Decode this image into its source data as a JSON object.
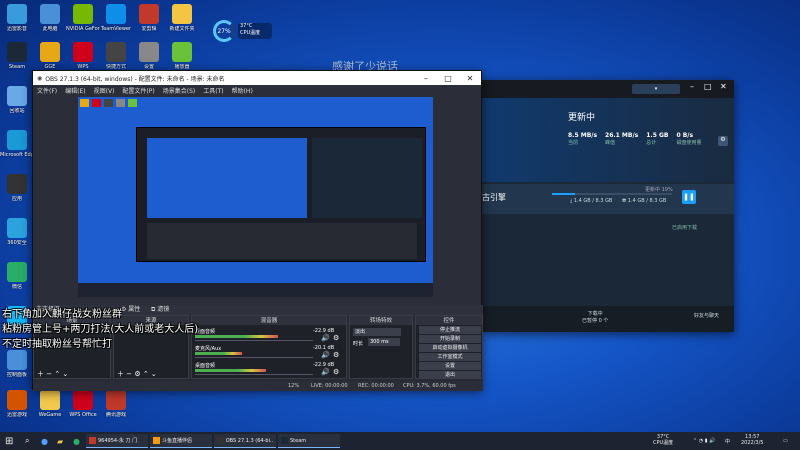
{
  "desktop": {
    "icons_top": [
      {
        "label": "迅雷影音",
        "icon": "app-icon",
        "color": "#3a9bdc"
      },
      {
        "label": "此电脑",
        "icon": "computer-icon",
        "color": "#4a90d9"
      },
      {
        "label": "NVIDIA GeForce",
        "icon": "nvidia-icon",
        "color": "#76b900"
      },
      {
        "label": "TeamViewer",
        "icon": "teamviewer-icon",
        "color": "#0e8ee9"
      },
      {
        "label": "爱剪辑",
        "icon": "app-icon",
        "color": "#c0392b"
      },
      {
        "label": "新建文件夹",
        "icon": "folder-icon",
        "color": "#f4c542"
      }
    ],
    "icons_row2": [
      {
        "label": "Steam",
        "icon": "steam-icon",
        "color": "#1b2838"
      },
      {
        "label": "GGE",
        "icon": "app-icon",
        "color": "#e6a817"
      },
      {
        "label": "WPS",
        "icon": "app-icon",
        "color": "#d0021b"
      },
      {
        "label": "快捷方式",
        "icon": "app-icon",
        "color": "#444"
      },
      {
        "label": "设置",
        "icon": "app-icon",
        "color": "#888"
      },
      {
        "label": "播放器",
        "icon": "play-icon",
        "color": "#6ac13a"
      }
    ],
    "icons_left": [
      {
        "label": "回收站",
        "icon": "recycle-bin-icon",
        "color": "#6aa9e9"
      },
      {
        "label": "Microsoft Edge",
        "icon": "edge-icon",
        "color": "#1a9ad6"
      },
      {
        "label": "应用",
        "icon": "app-icon",
        "color": "#333"
      },
      {
        "label": "360安全",
        "icon": "app-icon",
        "color": "#2aa3e0"
      },
      {
        "label": "微信",
        "icon": "wechat-icon",
        "color": "#2aae67"
      },
      {
        "label": "QQ",
        "icon": "qq-icon",
        "color": "#12b7f5"
      },
      {
        "label": "控制面板",
        "icon": "app-icon",
        "color": "#4a90d9"
      }
    ],
    "icons_bottom": [
      {
        "label": "迅雷游戏",
        "icon": "app-icon",
        "color": "#d35400"
      },
      {
        "label": "WeGame",
        "icon": "app-icon",
        "color": "#f2c94c"
      },
      {
        "label": "WPS Office",
        "icon": "app-icon",
        "color": "#d0021b"
      },
      {
        "label": "腾讯游戏",
        "icon": "app-icon",
        "color": "#c0392b"
      }
    ]
  },
  "temp_widget": {
    "value": "27%",
    "line1": "37°C",
    "line2": "CPU温度"
  },
  "watermark": "感谢了少说话",
  "obs": {
    "title": "OBS 27.1.3 (64-bit, windows) - 配置文件: 未命名 - 场景: 未命名",
    "menu": [
      "文件(F)",
      "编辑(E)",
      "视图(V)",
      "配置文件(P)",
      "场景集合(S)",
      "工具(T)",
      "帮助(H)"
    ],
    "scenes_label": "来源",
    "source_tab": "场景",
    "audio_label": "混音器",
    "transition_label": "转场特效",
    "controls_label": "控件",
    "source_unselected": "未选择源",
    "properties_btn": "属性",
    "filters_btn": "滤镜",
    "audio_tracks": [
      {
        "name": "桌面音频",
        "db": "-22.9 dB",
        "level": 0.7
      },
      {
        "name": "麦克风/Aux",
        "db": "-20.1 dB",
        "level": 0.4
      },
      {
        "name": "桌面音频",
        "db": "-22.9 dB",
        "level": 0.6
      }
    ],
    "transition": "淡出",
    "duration_label": "时长",
    "duration": "300 ms",
    "control_buttons": [
      "停止推流",
      "开始录制",
      "启动虚拟摄像机",
      "工作室模式",
      "设置",
      "退出"
    ],
    "status": {
      "live_label": "LIVE:",
      "live_time": "00:00:00",
      "rec_label": "REC:",
      "rec_time": "00:00:00",
      "cpu": "CPU: 3.7%, 60.00 fps",
      "fps": "12%"
    }
  },
  "steam": {
    "header": "更新中",
    "stats": [
      {
        "value": "8.5 MB/s",
        "label": "当前"
      },
      {
        "value": "26.1 MB/s",
        "label": "峰值"
      },
      {
        "value": "1.5 GB",
        "label": "总计"
      },
      {
        "value": "0 B/s",
        "label": "磁盘使用量"
      }
    ],
    "game_title": "古引擎",
    "progress_label": "更新中 19%",
    "progress": 0.19,
    "downloaded": "1.4 GB / 8.3 GB",
    "disk": "1.4 GB / 8.3 GB",
    "queue_label": "已启用下载",
    "footer_left": "下载中",
    "footer_sub": "已暂停 0 个",
    "footer_right": "好友与聊天"
  },
  "overlay_lines": [
    "右下角加入麒仔战女粉丝群",
    "粘粉房管上号+两刀打法(大人前或老大人后)",
    "不定时抽取粉丝号帮忙打"
  ],
  "taskbar": {
    "items": [
      {
        "label": "964954-永 刀 门",
        "icon": "app-icon",
        "color": "#c0392b"
      },
      {
        "label": "斗鱼直播伴侣",
        "icon": "app-icon",
        "color": "#f39c12"
      },
      {
        "label": "OBS 27.1.3 (64-bi...",
        "icon": "obs-icon",
        "color": "#333"
      },
      {
        "label": "Steam",
        "icon": "steam-icon",
        "color": "#1b2838"
      }
    ],
    "temp": "37°C",
    "temp_label": "CPU温度",
    "time": "13:57",
    "date": "2022/3/5",
    "lang": "中"
  }
}
